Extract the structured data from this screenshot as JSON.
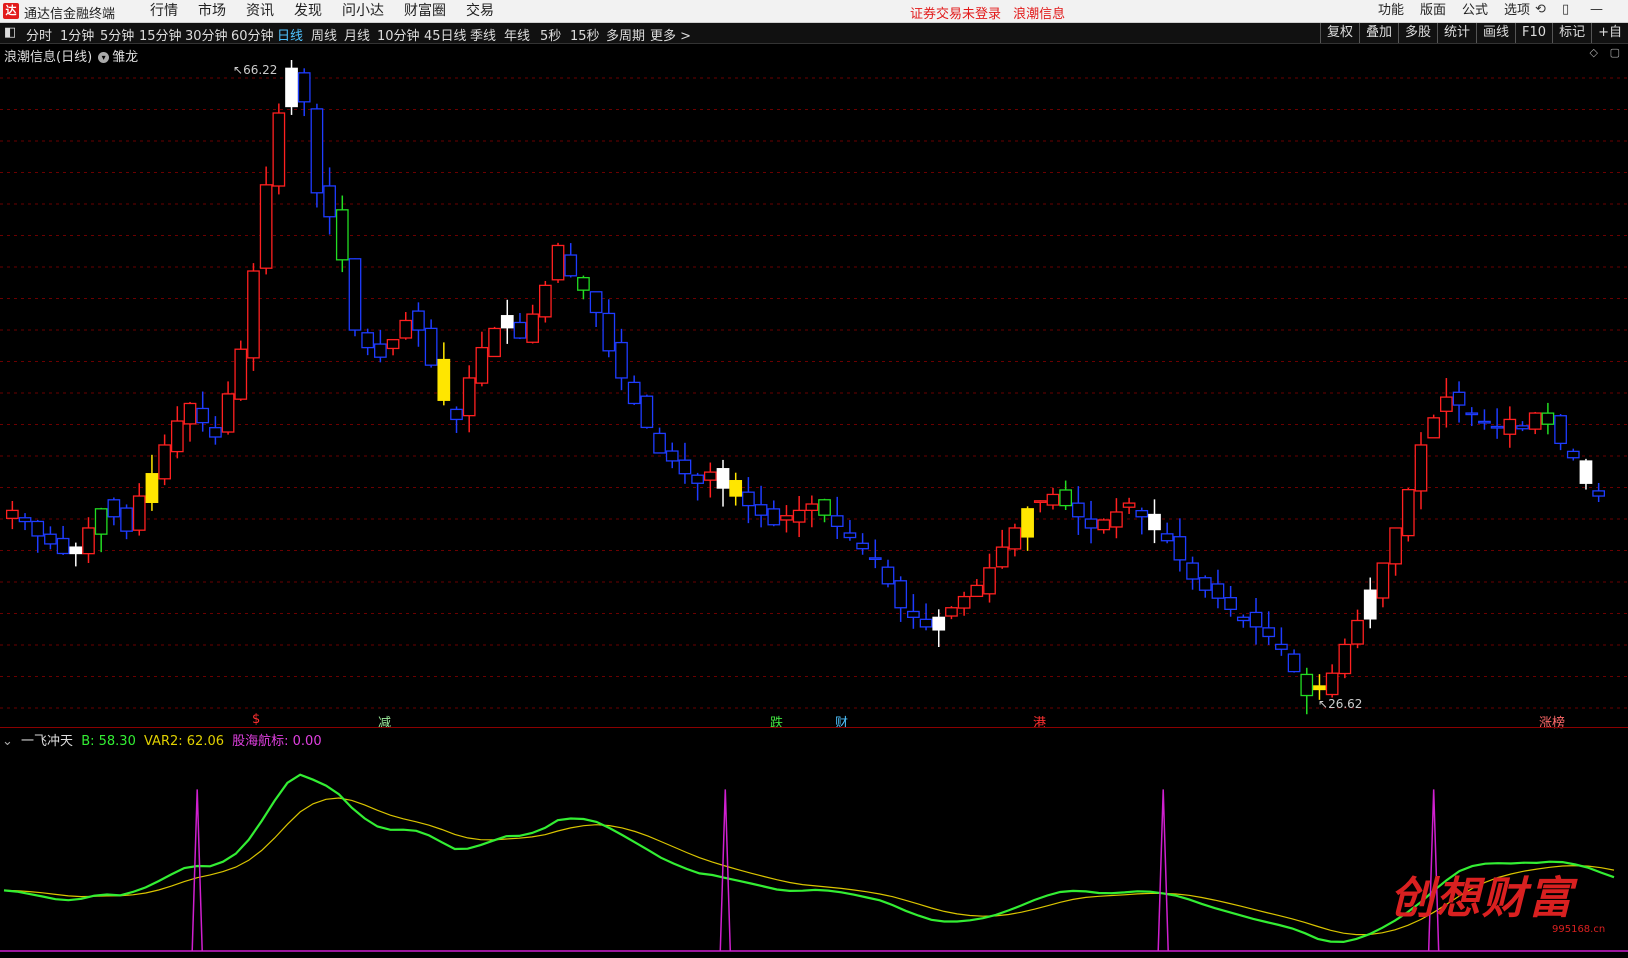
{
  "app": {
    "logo": "达",
    "title": "通达信金融终端"
  },
  "menu": [
    "行情",
    "市场",
    "资讯",
    "发现",
    "问小达",
    "财富圈",
    "交易"
  ],
  "notice": {
    "login": "证券交易未登录",
    "stock": "浪潮信息"
  },
  "right_menu": [
    "功能",
    "版面",
    "公式",
    "选项"
  ],
  "periods": [
    "分时",
    "1分钟",
    "5分钟",
    "15分钟",
    "30分钟",
    "60分钟",
    "日线",
    "周线",
    "月线",
    "10分钟",
    "45日线",
    "季线",
    "年线",
    "5秒",
    "15秒",
    "多周期",
    "更多 >"
  ],
  "active_period": "日线",
  "right_tools": [
    "复权",
    "叠加",
    "多股",
    "统计",
    "画线",
    "F10",
    "标记",
    "+自"
  ],
  "stock": {
    "name": "浪潮信息(日线)",
    "tag": "雏龙"
  },
  "price_labels": {
    "high": "66.22",
    "low": "26.62"
  },
  "signals": [
    "$",
    "减",
    "跌",
    "财",
    "港",
    "涨榜"
  ],
  "indicator": {
    "name": "一飞冲天",
    "b_label": "B: 58.30",
    "var2_label": "VAR2: 62.06",
    "gh_label": "股海航标: 0.00"
  },
  "colors": {
    "up": "#ff2020",
    "down": "#1e3cff",
    "green": "#22dd22",
    "yellow": "#ffe600",
    "white": "#ffffff",
    "green_line": "#33ee33",
    "yellow_line": "#d9c400",
    "spike": "#d020d0"
  },
  "watermark": {
    "text": "创想财富",
    "url": "995168.cn"
  },
  "chart_data": {
    "type": "candlestick",
    "price_range": [
      26.62,
      66.22
    ],
    "indicator_range": [
      0,
      100
    ],
    "spike_index": [
      15,
      56,
      90,
      111,
      165,
      175
    ],
    "closes": [
      38.5,
      37.8,
      36.9,
      36.4,
      35.8,
      36.2,
      37.4,
      38.6,
      38.1,
      37.2,
      39.4,
      40.8,
      42.6,
      44.1,
      45.2,
      44.0,
      43.1,
      45.8,
      48.6,
      53.5,
      58.9,
      63.4,
      66.2,
      64.1,
      58.4,
      56.9,
      54.2,
      49.8,
      48.7,
      48.1,
      49.2,
      50.4,
      49.8,
      47.6,
      45.4,
      44.2,
      46.8,
      48.7,
      49.9,
      50.7,
      49.3,
      50.8,
      52.6,
      55.1,
      53.2,
      52.3,
      50.9,
      48.5,
      46.8,
      45.2,
      43.7,
      42.1,
      41.6,
      40.8,
      40.2,
      40.9,
      39.9,
      39.4,
      38.8,
      38.2,
      37.6,
      37.9,
      38.5,
      38.9,
      38.2,
      37.5,
      36.8,
      36.1,
      35.5,
      33.9,
      32.4,
      31.8,
      31.2,
      31.8,
      32.4,
      33.1,
      33.8,
      34.9,
      36.2,
      37.4,
      38.6,
      39.1,
      39.5,
      38.8,
      38.1,
      37.4,
      37.9,
      38.4,
      38.7,
      38.1,
      37.3,
      36.6,
      35.4,
      34.2,
      33.5,
      33.0,
      32.3,
      31.6,
      31.2,
      30.6,
      29.8,
      28.4,
      26.9,
      27.5,
      28.3,
      30.1,
      31.6,
      33.5,
      35.2,
      37.4,
      39.8,
      42.6,
      44.3,
      45.6,
      45.1,
      44.6,
      44.0,
      43.7,
      44.2,
      43.8,
      44.6,
      43.9,
      42.7,
      41.8,
      40.2,
      39.4
    ]
  }
}
